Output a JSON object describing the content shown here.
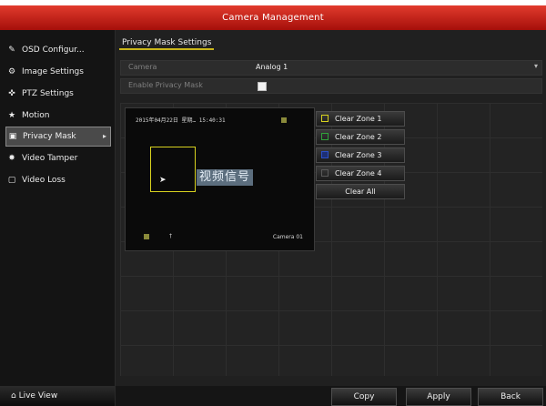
{
  "window": {
    "title": "Camera Management"
  },
  "sidebar": {
    "items": [
      {
        "label": "OSD Configur...",
        "icon": "brush-icon",
        "glyph": "✎"
      },
      {
        "label": "Image Settings",
        "icon": "image-settings-icon",
        "glyph": "⚙"
      },
      {
        "label": "PTZ Settings",
        "icon": "ptz-icon",
        "glyph": "✜"
      },
      {
        "label": "Motion",
        "icon": "motion-icon",
        "glyph": "★"
      },
      {
        "label": "Privacy Mask",
        "icon": "privacy-mask-icon",
        "glyph": "▣"
      },
      {
        "label": "Video Tamper",
        "icon": "tamper-icon",
        "glyph": "✸"
      },
      {
        "label": "Video Loss",
        "icon": "video-loss-icon",
        "glyph": "▢"
      }
    ],
    "active_index": 4,
    "live_view": {
      "label": "Live View",
      "glyph": "⌂"
    }
  },
  "main": {
    "tab_label": "Privacy Mask  Settings",
    "camera": {
      "label": "Camera",
      "value": "Analog  1"
    },
    "enable": {
      "label": "Enable Privacy Mask",
      "checked": true
    },
    "preview": {
      "timestamp": "2015年04月22日 星期…  15:40:31",
      "no_signal": "视频信号",
      "camera_label": "Camera 01",
      "small_mark": "†"
    },
    "zones": [
      {
        "label": "Clear Zone 1",
        "color": "#d8d21f"
      },
      {
        "label": "Clear Zone 2",
        "color": "#2fa33a"
      },
      {
        "label": "Clear Zone 3",
        "color": "#2b4fc7"
      },
      {
        "label": "Clear Zone 4",
        "color": "#5a5a5a"
      }
    ],
    "clear_all": "Clear All"
  },
  "footer": {
    "copy": "Copy",
    "apply": "Apply",
    "back": "Back"
  }
}
